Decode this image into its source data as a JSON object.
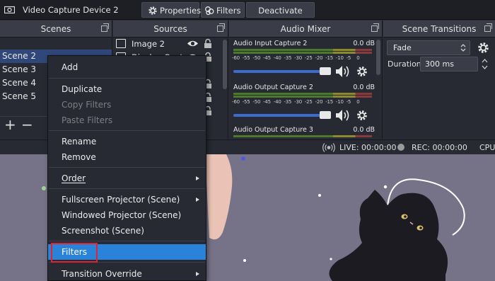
{
  "topbar": {
    "device_label": "Video Capture Device 2",
    "properties_label": "Properties",
    "filters_label": "Filters",
    "deactivate_label": "Deactivate"
  },
  "docks": {
    "scenes_title": "Scenes",
    "sources_title": "Sources",
    "mixer_title": "Audio Mixer",
    "transitions_title": "Scene Transitions"
  },
  "scenes": [
    "Scene 2",
    "Scene 3",
    "Scene 4",
    "Scene 5"
  ],
  "sources": [
    "Image 2",
    "Display Capture"
  ],
  "mixer": {
    "ticks": [
      "-60",
      "-55",
      "-50",
      "-45",
      "-40",
      "-35",
      "-30",
      "-25",
      "-20",
      "-15",
      "-10",
      "-5",
      "0"
    ],
    "channels": [
      {
        "name": "Audio Input Capture 2",
        "db": "0.0 dB",
        "volume": 1.0
      },
      {
        "name": "Audio Output Capture 2",
        "db": "0.0 dB",
        "volume": 1.0
      },
      {
        "name": "Audio Output Capture 3",
        "db": "0.0 dB"
      }
    ]
  },
  "transitions": {
    "selected": "Fade",
    "duration_label": "Duration",
    "duration_value": "300 ms"
  },
  "status": {
    "live": "LIVE: 00:00:00",
    "rec": "REC: 00:00:00",
    "cpu": "CPU"
  },
  "context_menu": {
    "add": "Add",
    "duplicate": "Duplicate",
    "copy_filters": "Copy Filters",
    "paste_filters": "Paste Filters",
    "rename": "Rename",
    "remove": "Remove",
    "order": "Order",
    "fullscreen_projector": "Fullscreen Projector (Scene)",
    "windowed_projector": "Windowed Projector (Scene)",
    "screenshot": "Screenshot (Scene)",
    "filters": "Filters",
    "transition_override": "Transition Override"
  },
  "colors": {
    "accent": "#2a82d9",
    "highlight_box": "#e0242a",
    "selection": "#30477a",
    "volume_bar": "#3d6bd0"
  }
}
